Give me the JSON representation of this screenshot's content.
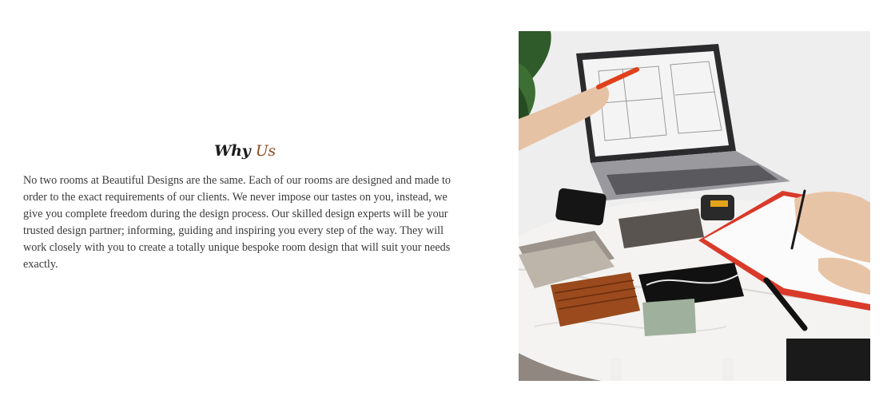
{
  "why_us": {
    "heading_word1": "Why",
    "heading_word2": "Us",
    "body": "No two rooms at Beautiful Designs are the same. Each of our rooms are designed and made to order to the exact requirements of our clients. We never impose our tastes on you, instead, we give you complete freedom during the design process. Our skilled design experts will be your trusted design partner; informing, guiding and inspiring you every step of the way. They will work closely with you to create a totally unique bespoke room design that will suit your needs exactly."
  },
  "photo": {
    "icon": "design-consultation-photo"
  },
  "colors": {
    "heading_dark": "#1c1c1c",
    "heading_accent": "#8a4a22",
    "body_text": "#3a3a3a"
  }
}
